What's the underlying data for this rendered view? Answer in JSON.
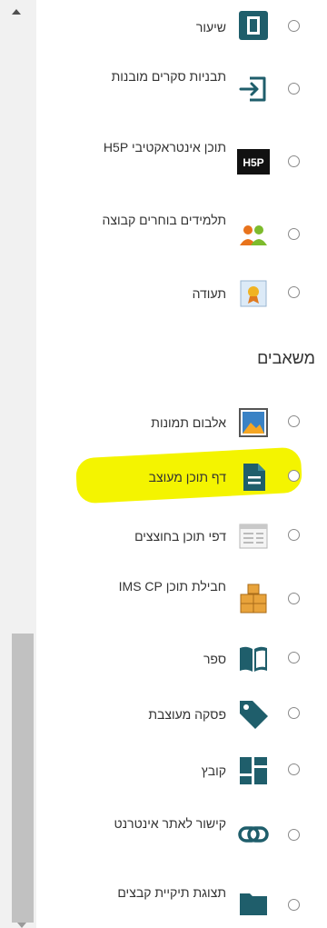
{
  "colors": {
    "teal": "#1f5e6b",
    "highlight": "#f4f400",
    "scroll_track": "#f1f1f1",
    "scroll_thumb": "#c1c1c1"
  },
  "activities": [
    {
      "label": "שיעור",
      "icon": "lesson-icon"
    },
    {
      "label": "תבניות סקרים מובנות",
      "icon": "survey-enter-icon"
    },
    {
      "label": "תוכן אינטראקטיבי H5P",
      "icon": "h5p-icon",
      "icon_text": "H5P"
    },
    {
      "label": "תלמידים בוחרים קבוצה",
      "icon": "group-choice-icon"
    },
    {
      "label": "תעודה",
      "icon": "certificate-icon"
    }
  ],
  "resources_title": "משאבים",
  "resources": [
    {
      "label": "אלבום תמונות",
      "icon": "image-album-icon"
    },
    {
      "label": "דף תוכן מעוצב",
      "icon": "page-icon",
      "highlighted": true
    },
    {
      "label": "דפי תוכן בחוצצים",
      "icon": "tabbed-pages-icon"
    },
    {
      "label": "חבילת תוכן IMS CP",
      "icon": "ims-package-icon"
    },
    {
      "label": "ספר",
      "icon": "book-icon"
    },
    {
      "label": "פסקה מעוצבת",
      "icon": "tag-icon"
    },
    {
      "label": "קובץ",
      "icon": "file-icon"
    },
    {
      "label": "קישור לאתר אינטרנט",
      "icon": "link-icon"
    },
    {
      "label": "תצוגת תיקיית קבצים",
      "icon": "folder-icon"
    }
  ]
}
